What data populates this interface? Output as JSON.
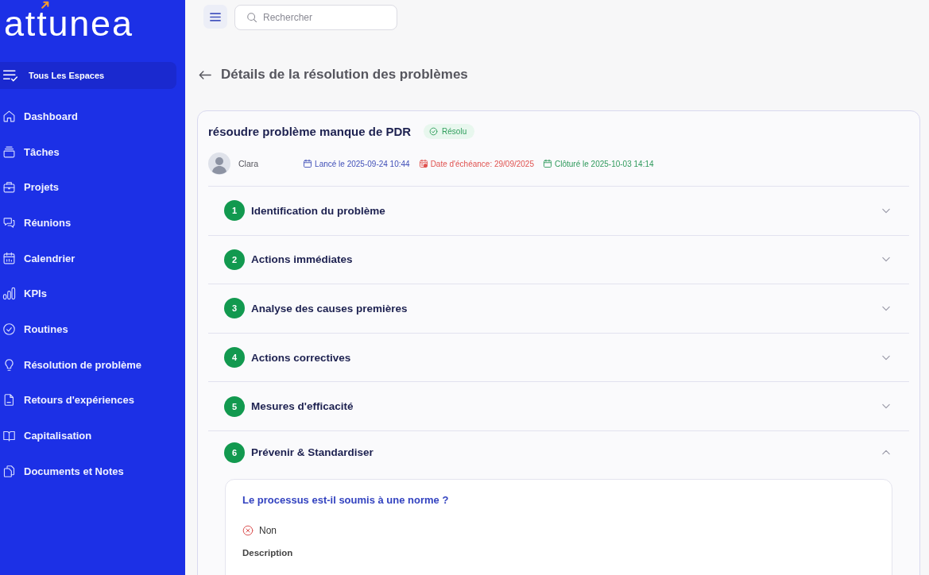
{
  "sidebar": {
    "logo": "attunea",
    "workspace": {
      "label": "Tous Les Espaces"
    },
    "items": [
      {
        "label": "Dashboard",
        "selected": false
      },
      {
        "label": "Tâches",
        "selected": false
      },
      {
        "label": "Projets",
        "selected": false
      },
      {
        "label": "Réunions",
        "selected": false
      },
      {
        "label": "Calendrier",
        "selected": false
      },
      {
        "label": "KPIs",
        "selected": false
      },
      {
        "label": "Routines",
        "selected": false
      },
      {
        "label": "Résolution de problème",
        "selected": false
      },
      {
        "label": "Retours d'expériences",
        "selected": false
      },
      {
        "label": "Capitalisation",
        "selected": false
      },
      {
        "label": "Documents et Notes",
        "selected": false
      }
    ]
  },
  "topbar": {
    "search": {
      "placeholder": "Rechercher"
    }
  },
  "page": {
    "title": "Détails de la résolution des problèmes"
  },
  "problem": {
    "title": "résoudre problème manque de PDR",
    "status": {
      "label": "Résolu",
      "kind": "resolved"
    },
    "owner": {
      "name": "Clara"
    },
    "dates": [
      {
        "kind": "launched",
        "text": "Lancé le 2025-09-24 10:44"
      },
      {
        "kind": "due",
        "text": "Date d'échéance: 29/09/2025"
      },
      {
        "kind": "closed",
        "text": "Clôturé le 2025-10-03 14:14"
      }
    ]
  },
  "steps": [
    {
      "number": "1",
      "title": "Identification du problème",
      "expanded": false
    },
    {
      "number": "2",
      "title": "Actions immédiates",
      "expanded": false
    },
    {
      "number": "3",
      "title": "Analyse des causes premières",
      "expanded": false
    },
    {
      "number": "4",
      "title": "Actions correctives",
      "expanded": false
    },
    {
      "number": "5",
      "title": "Mesures d'efficacité",
      "expanded": false
    },
    {
      "number": "6",
      "title": "Prévenir & Standardiser",
      "expanded": true,
      "questions": [
        {
          "text": "Le processus est-il soumis à une norme ?",
          "answer": {
            "label": "Non",
            "positive": false
          },
          "description_label": "Description"
        }
      ]
    }
  ]
}
